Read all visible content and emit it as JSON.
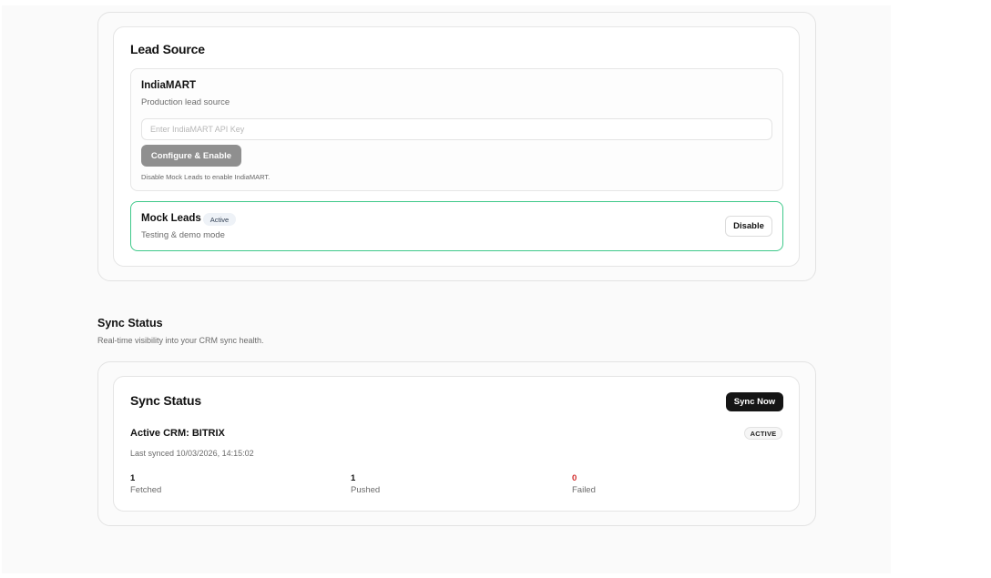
{
  "lead_source": {
    "title": "Lead Source",
    "indiamart": {
      "name": "IndiaMART",
      "description": "Production lead source",
      "api_key_value": "",
      "api_key_placeholder": "Enter IndiaMART API Key",
      "configure_label": "Configure & Enable",
      "hint": "Disable Mock Leads to enable IndiaMART."
    },
    "mock_leads": {
      "name": "Mock Leads",
      "badge": "Active",
      "description": "Testing & demo mode",
      "disable_label": "Disable"
    }
  },
  "sync_section": {
    "title": "Sync Status",
    "subtitle": "Real-time visibility into your CRM sync health."
  },
  "sync_card": {
    "title": "Sync Status",
    "sync_now_label": "Sync Now",
    "active_crm": "Active CRM: BITRIX",
    "status_badge": "ACTIVE",
    "last_synced": "Last synced 10/03/2026, 14:15:02",
    "stats": [
      {
        "value": "1",
        "label": "Fetched"
      },
      {
        "value": "1",
        "label": "Pushed"
      },
      {
        "value": "0",
        "label": "Failed"
      }
    ]
  },
  "colors": {
    "active_border": "#3fc98a",
    "failed": "#d32f2f",
    "dark_button": "#151515",
    "disabled_button": "#8f8f8f"
  }
}
